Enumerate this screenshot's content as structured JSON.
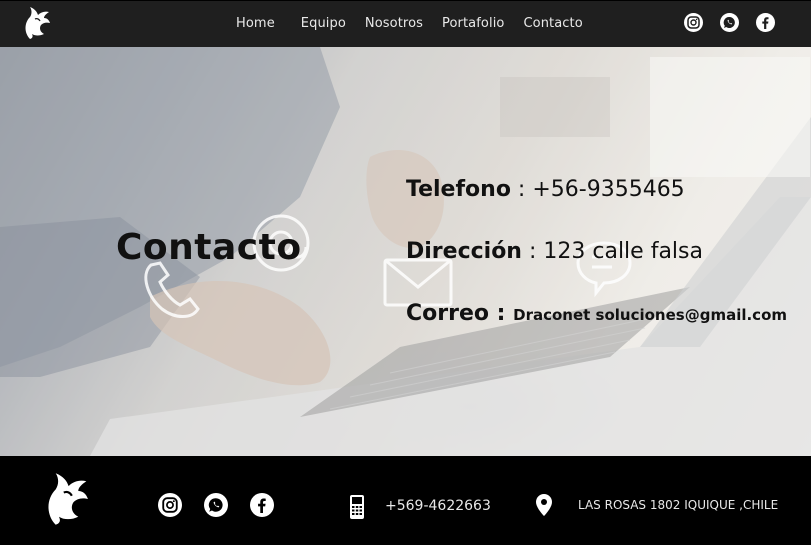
{
  "header": {
    "nav": [
      "Home",
      "Equipo",
      "Nosotros",
      "Portafolio",
      "Contacto"
    ],
    "social": [
      "instagram-icon",
      "whatsapp-icon",
      "facebook-icon"
    ]
  },
  "hero": {
    "title": "Contacto",
    "telefono_label": "Telefono",
    "telefono_value": " : +56-9355465",
    "direccion_label": "Dirección",
    "direccion_value": " : 123 calle falsa",
    "correo_label": "Correo : ",
    "correo_value": "Draconet soluciones@gmail.com"
  },
  "footer": {
    "phone": "+569-4622663",
    "address": "LAS ROSAS 1802 IQUIQUE ,CHILE",
    "social": [
      "instagram-icon",
      "whatsapp-icon",
      "facebook-icon"
    ]
  },
  "colors": {
    "header_bg": "#1f1f1f",
    "footer_bg": "#000000",
    "text_dark": "#111111",
    "text_light": "#e8e8e8"
  }
}
